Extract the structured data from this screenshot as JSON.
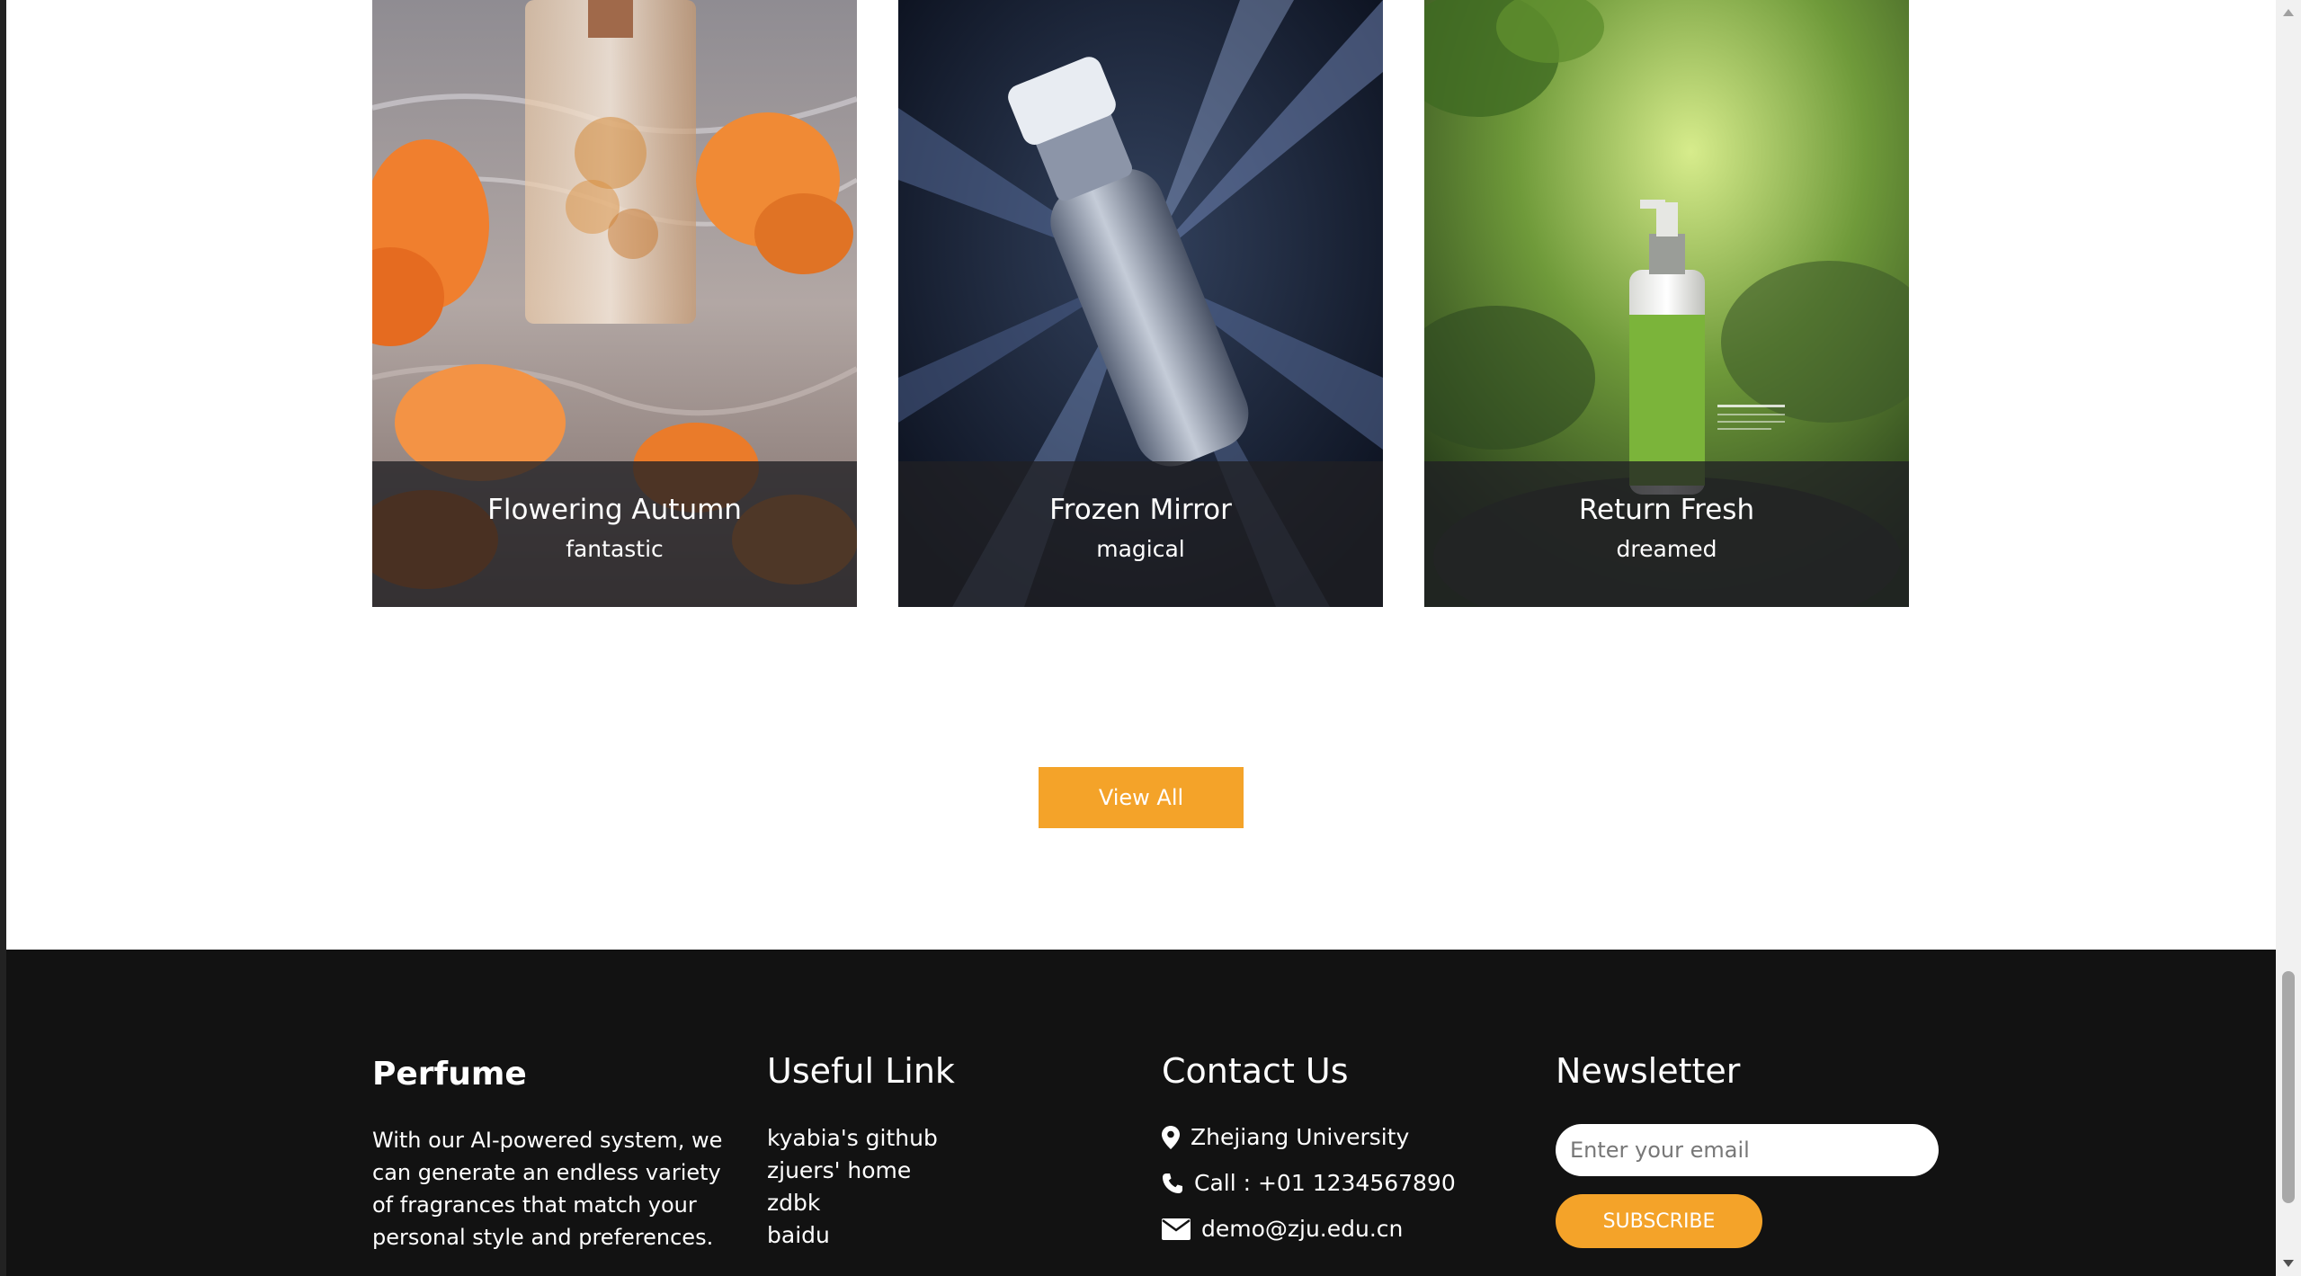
{
  "cards": [
    {
      "title": "Flowering Autumn",
      "subtitle": "fantastic"
    },
    {
      "title": "Frozen Mirror",
      "subtitle": "magical"
    },
    {
      "title": "Return Fresh",
      "subtitle": "dreamed"
    }
  ],
  "view_all_label": "View All",
  "footer": {
    "brand": {
      "title": "Perfume",
      "description": "With our AI-powered system, we can generate an endless variety of fragrances that match your personal style and preferences."
    },
    "links": {
      "title": "Useful Link",
      "items": [
        "kyabia's github",
        "zjuers' home",
        "zdbk",
        "baidu"
      ]
    },
    "contact": {
      "title": "Contact Us",
      "location": "Zhejiang University",
      "phone": "Call : +01 1234567890",
      "email": "demo@zju.edu.cn"
    },
    "newsletter": {
      "title": "Newsletter",
      "placeholder": "Enter your email",
      "button": "SUBSCRIBE"
    }
  },
  "colors": {
    "accent": "#f4a329",
    "footer_bg": "#121212"
  },
  "icons": [
    "map-pin-icon",
    "phone-icon",
    "envelope-icon"
  ]
}
